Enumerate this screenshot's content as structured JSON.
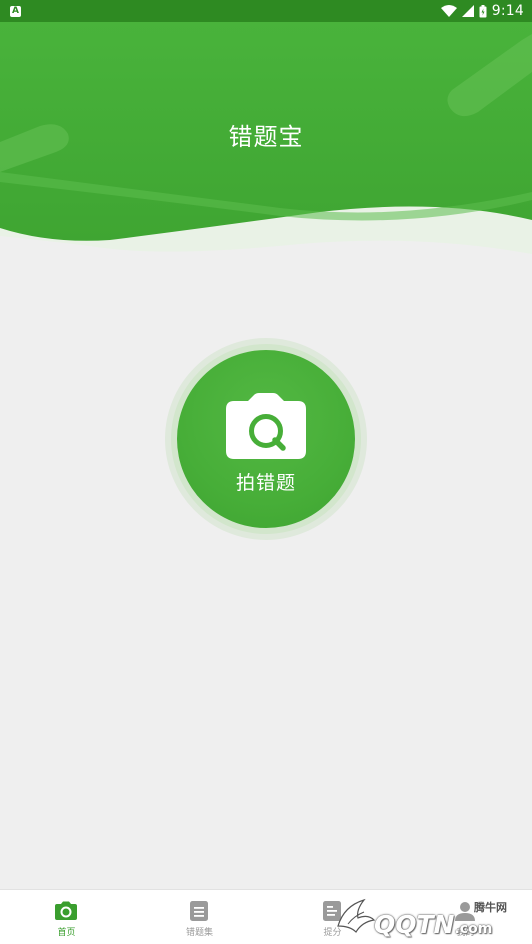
{
  "status_bar": {
    "notification_icon": "A",
    "time": "9:14",
    "icons": [
      "wifi-icon",
      "cellular-signal-icon",
      "battery-icon"
    ]
  },
  "header": {
    "title": "错题宝"
  },
  "capture": {
    "label": "拍错题",
    "icon": "camera-search-icon"
  },
  "bottom_nav": {
    "items": [
      {
        "label": "首页",
        "icon": "camera-icon",
        "active": true
      },
      {
        "label": "错题集",
        "icon": "document-icon",
        "active": false
      },
      {
        "label": "提分",
        "icon": "chart-icon",
        "active": false
      },
      {
        "label": "我的",
        "icon": "user-icon",
        "active": false
      }
    ]
  },
  "watermark": {
    "cn_text": "腾牛网",
    "logo_main": "QQTN",
    "logo_suffix": ".com"
  },
  "colors": {
    "primary_green": "#47ae38",
    "status_bar": "#2e8a22",
    "background": "#efefef",
    "nav_active": "#3a9e2e",
    "nav_inactive": "#9a9a9a"
  }
}
